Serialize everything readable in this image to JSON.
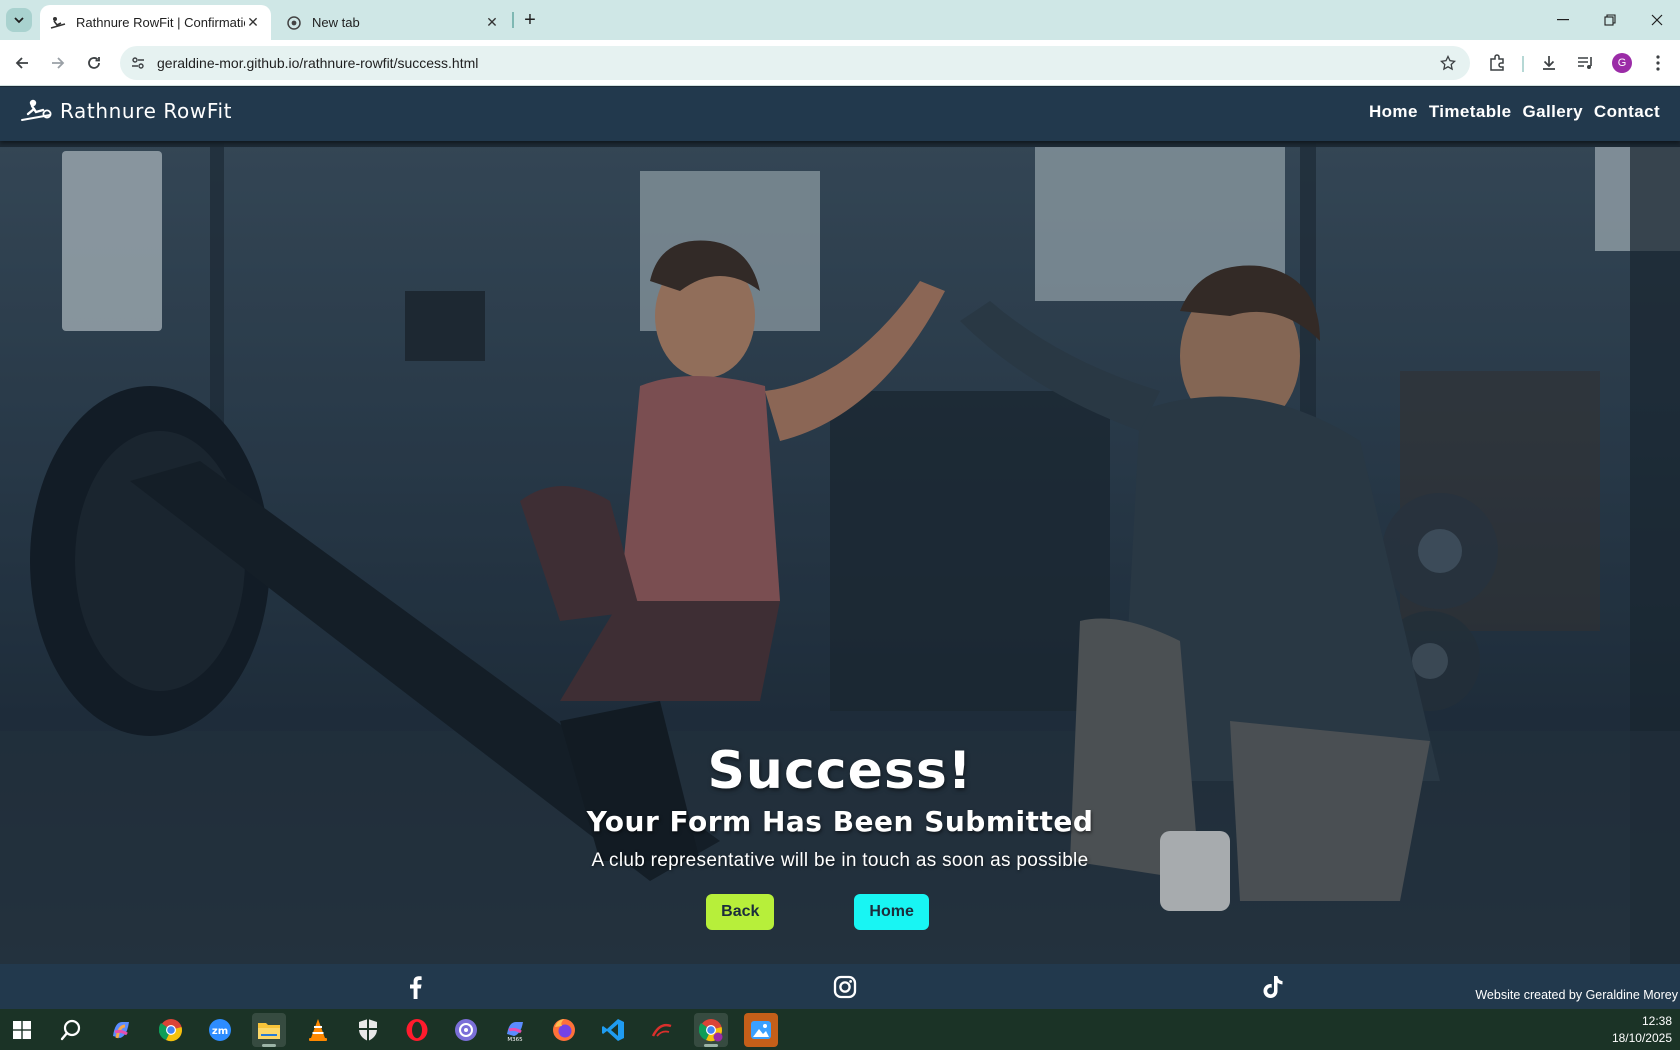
{
  "browser": {
    "tabs": [
      {
        "title": "Rathnure RowFit | Confirmation",
        "active": true
      },
      {
        "title": "New tab",
        "active": false
      }
    ],
    "url": "geraldine-mor.github.io/rathnure-rowfit/success.html",
    "profile_initial": "G"
  },
  "site": {
    "brand": "Rathnure RowFit",
    "nav": [
      "Home",
      "Timetable",
      "Gallery",
      "Contact"
    ]
  },
  "hero": {
    "heading": "Success!",
    "subheading": "Your Form Has Been Submitted",
    "message": "A club representative will be in touch as soon as possible",
    "back_label": "Back",
    "home_label": "Home"
  },
  "footer": {
    "social_icons": [
      "facebook-icon",
      "instagram-icon",
      "tiktok-icon"
    ],
    "credit": "Website created by Geraldine Morey"
  },
  "taskbar": {
    "apps": [
      "windows-start-icon",
      "search-icon",
      "copilot-icon",
      "chrome-icon",
      "zoom-icon",
      "file-explorer-icon",
      "vlc-icon",
      "security-icon",
      "opera-icon",
      "app-icon",
      "m365-icon",
      "firefox-icon",
      "vscode-icon",
      "app-icon",
      "chrome-profile-icon",
      "photos-icon"
    ],
    "time": "12:38",
    "date": "18/10/2025"
  },
  "colors": {
    "nav_bg": "#22394d",
    "back_button": "#b7ef3a",
    "home_button": "#18f5f3",
    "taskbar_bg": "#1b3326",
    "tabstrip_bg": "#cfe7e6"
  }
}
